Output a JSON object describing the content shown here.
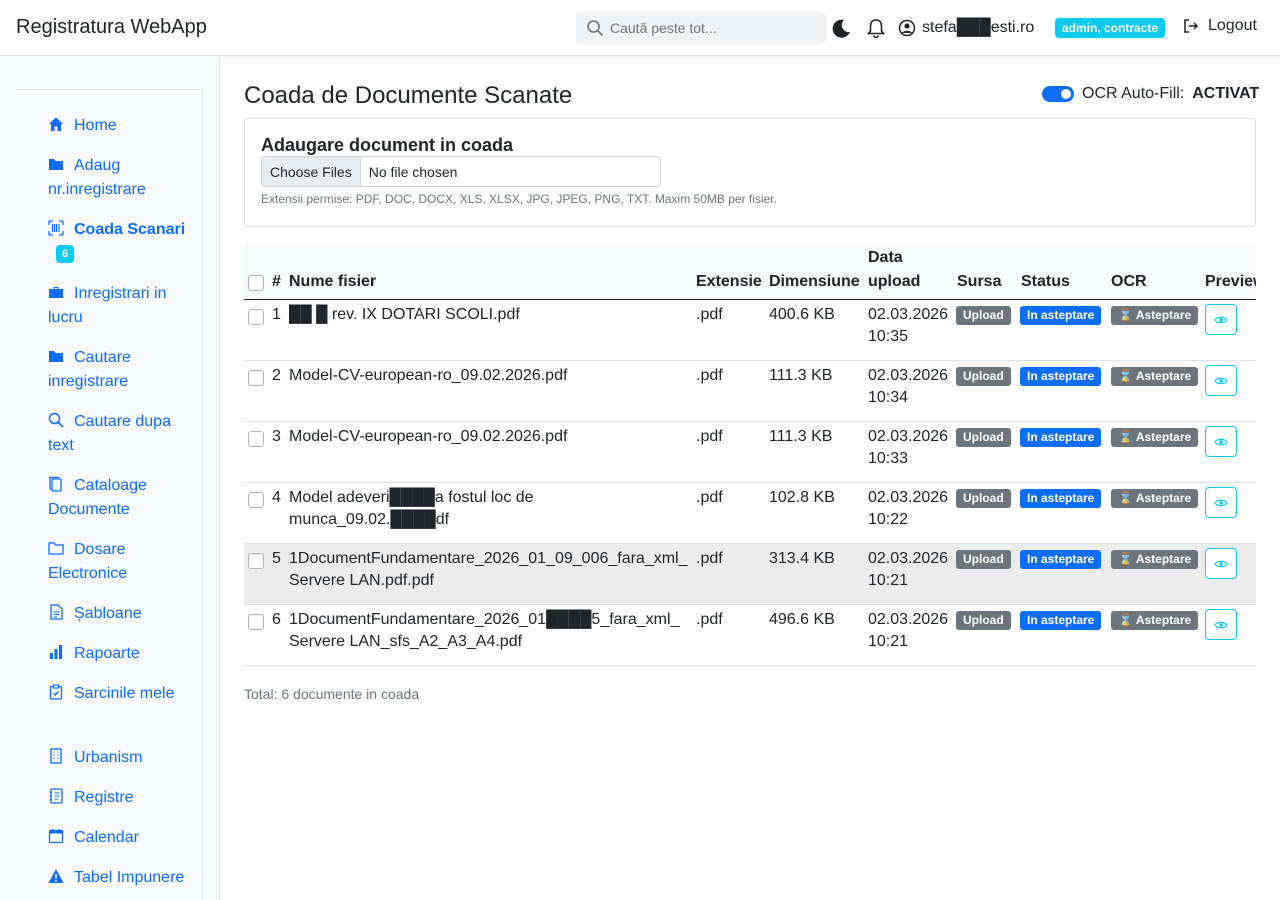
{
  "app": {
    "title": "Registratura WebApp"
  },
  "search": {
    "placeholder": "Caută peste tot..."
  },
  "user": {
    "email": "stefa███esti.ro",
    "role": "admin, contracte",
    "logout": "Logout"
  },
  "sidebar": {
    "items": [
      {
        "label": "Home",
        "icon": "home-icon"
      },
      {
        "label": "Adaug nr.inregistrare",
        "icon": "folder-icon"
      },
      {
        "label": "Coada Scanari",
        "icon": "barcode-icon",
        "badge": "6"
      },
      {
        "label": "Inregistrari in lucru",
        "icon": "briefcase-icon"
      },
      {
        "label": "Cautare inregistrare",
        "icon": "folder-icon"
      },
      {
        "label": "Cautare dupa text",
        "icon": "search-icon"
      },
      {
        "label": "Cataloage Documente",
        "icon": "copy-icon"
      },
      {
        "label": "Dosare Electronice",
        "icon": "folder-outline-icon"
      },
      {
        "label": "Șabloane",
        "icon": "file-text-icon"
      },
      {
        "label": "Rapoarte",
        "icon": "bar-chart-icon"
      },
      {
        "label": "Sarcinile mele",
        "icon": "clipboard-icon"
      },
      {
        "label": "Urbanism",
        "icon": "building-icon"
      },
      {
        "label": "Registre",
        "icon": "journal-icon"
      },
      {
        "label": "Calendar",
        "icon": "calendar-icon"
      },
      {
        "label": "Tabel Impunere",
        "icon": "warning-icon"
      }
    ]
  },
  "main": {
    "title": "Coada de Documente Scanate",
    "ocr_label": "OCR Auto-Fill:",
    "ocr_state": "ACTIVAT",
    "upload": {
      "heading": "Adaugare document in coada",
      "button": "Choose Files",
      "no_file": "No file chosen",
      "hint": "Extensii permise: PDF, DOC, DOCX, XLS, XLSX, JPG, JPEG, PNG, TXT. Maxim 50MB per fisier."
    },
    "table": {
      "headers": {
        "num": "#",
        "name": "Nume fisier",
        "ext": "Extensie",
        "size": "Dimensiune",
        "date1": "Data",
        "date2": "upload",
        "source": "Sursa",
        "status": "Status",
        "ocr": "OCR",
        "preview": "Preview"
      },
      "rows": [
        {
          "n": "1",
          "name1": "██ █ rev. IX DOTARI SCOLI.pdf",
          "name2": "",
          "ext": ".pdf",
          "size": "400.6 KB",
          "date": "02.03.2026",
          "time": "10:35",
          "source": "Upload",
          "status": "In asteptare",
          "ocr": "⌛ Asteptare"
        },
        {
          "n": "2",
          "name1": "Model-CV-european-ro_09.02.2026.pdf",
          "name2": "",
          "ext": ".pdf",
          "size": "111.3 KB",
          "date": "02.03.2026",
          "time": "10:34",
          "source": "Upload",
          "status": "In asteptare",
          "ocr": "⌛ Asteptare"
        },
        {
          "n": "3",
          "name1": "Model-CV-european-ro_09.02.2026.pdf",
          "name2": "",
          "ext": ".pdf",
          "size": "111.3 KB",
          "date": "02.03.2026",
          "time": "10:33",
          "source": "Upload",
          "status": "In asteptare",
          "ocr": "⌛ Asteptare"
        },
        {
          "n": "4",
          "name1": "Model adeveri████a fostul loc de",
          "name2": "munca_09.02.████df",
          "ext": ".pdf",
          "size": "102.8 KB",
          "date": "02.03.2026",
          "time": "10:22",
          "source": "Upload",
          "status": "In asteptare",
          "ocr": "⌛ Asteptare"
        },
        {
          "n": "5",
          "name1": "1DocumentFundamentare_2026_01_09_006_fara_xml_",
          "name2": "Servere LAN.pdf.pdf",
          "ext": ".pdf",
          "size": "313.4 KB",
          "date": "02.03.2026",
          "time": "10:21",
          "source": "Upload",
          "status": "In asteptare",
          "ocr": "⌛ Asteptare"
        },
        {
          "n": "6",
          "name1": "1DocumentFundamentare_2026_01████5_fara_xml_",
          "name2": "Servere LAN_sfs_A2_A3_A4.pdf",
          "ext": ".pdf",
          "size": "496.6 KB",
          "date": "02.03.2026",
          "time": "10:21",
          "source": "Upload",
          "status": "In asteptare",
          "ocr": "⌛ Asteptare"
        }
      ]
    },
    "total": "Total: 6 documente in coada"
  },
  "colors": {
    "primary": "#0d6efd",
    "info": "#0dcaf0",
    "secondary": "#6c757d"
  }
}
